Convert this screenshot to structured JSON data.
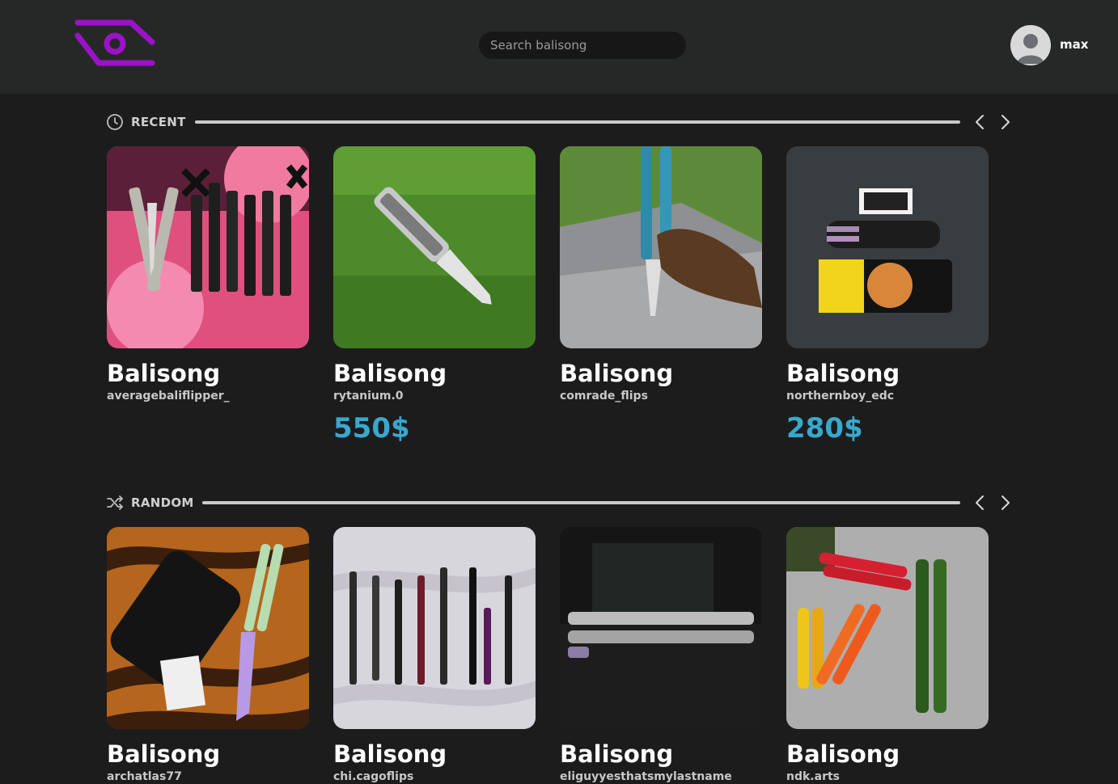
{
  "header": {
    "logo_icon": "eye-logo-icon",
    "brand_color": "#9b13c9",
    "search": {
      "placeholder": "Search balisong",
      "value": ""
    },
    "user": {
      "name": "max",
      "avatar_icon": "user-avatar-icon"
    }
  },
  "sections": [
    {
      "title": "RECENT",
      "icon": "clock-icon",
      "prev_icon": "chevron-left-icon",
      "next_icon": "chevron-right-icon",
      "cards": [
        {
          "title": "Balisong",
          "user": "averagebaliflipper_",
          "price": ""
        },
        {
          "title": "Balisong",
          "user": "rytanium.0",
          "price": "550$"
        },
        {
          "title": "Balisong",
          "user": "comrade_flips",
          "price": ""
        },
        {
          "title": "Balisong",
          "user": "northernboy_edc",
          "price": "280$"
        }
      ]
    },
    {
      "title": "RANDOM",
      "icon": "shuffle-icon",
      "prev_icon": "chevron-left-icon",
      "next_icon": "chevron-right-icon",
      "cards": [
        {
          "title": "Balisong",
          "user": "archatlas77",
          "price": ""
        },
        {
          "title": "Balisong",
          "user": "chi.cagoflips",
          "price": ""
        },
        {
          "title": "Balisong",
          "user": "eliguyyesthatsmylastname",
          "price": ""
        },
        {
          "title": "Balisong",
          "user": "ndk.arts",
          "price": ""
        }
      ]
    }
  ],
  "colors": {
    "price": "#39a8cc",
    "background": "#1c1c1d",
    "topbar": "#262828"
  }
}
